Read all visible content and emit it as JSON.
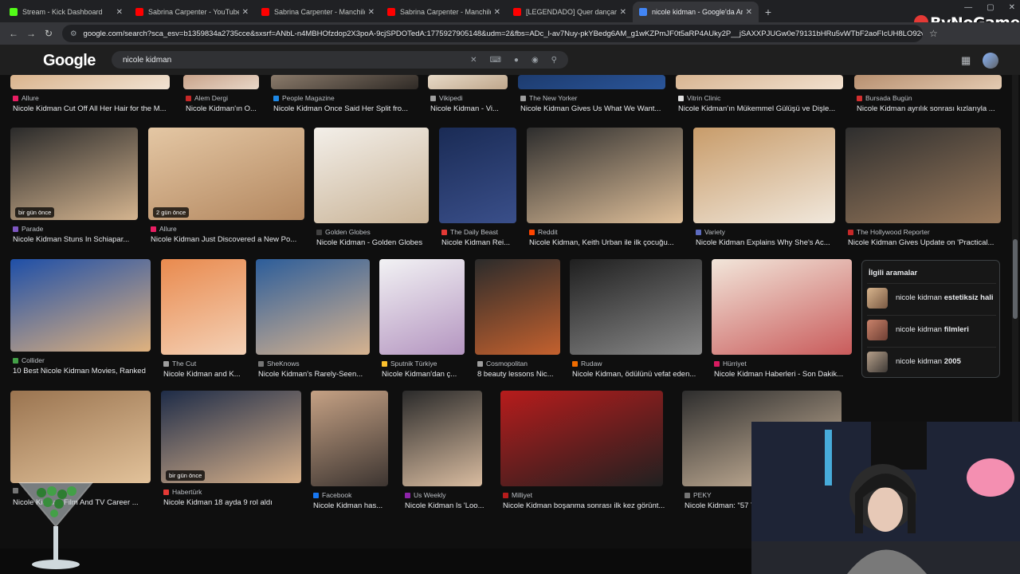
{
  "browser": {
    "tabs": [
      {
        "label": "Stream - Kick Dashboard",
        "favicon": "kick-icon",
        "color": "#53fc18",
        "active": false
      },
      {
        "label": "Sabrina Carpenter - YouTube",
        "favicon": "youtube-icon",
        "color": "#ff0000",
        "active": false
      },
      {
        "label": "Sabrina Carpenter - Manchild (",
        "favicon": "youtube-icon",
        "color": "#ff0000",
        "active": false
      },
      {
        "label": "Sabrina Carpenter - Manchild (",
        "favicon": "youtube-icon",
        "color": "#ff0000",
        "active": false
      },
      {
        "label": "[LEGENDADO] Quer dançar? Aı",
        "favicon": "youtube-icon",
        "color": "#ff0000",
        "active": false
      },
      {
        "label": "nicole kidman - Google'da Ara",
        "favicon": "google-icon",
        "color": "#4285f4",
        "active": true
      }
    ],
    "url": "google.com/search?sca_esv=b1359834a2735cce&sxsrf=ANbL-n4MBHOfzdop2X3poA-9cjSPDOTedA:1775927905148&udm=2&fbs=ADc_l-av7Nuy-pkYBedg6AM_g1wKZPmJF0t5aRP4AUky2P__jSAXXPJUGw0e79131bHRu5vWTbF2aoFIcUH8LO92vcJatS...",
    "overlay_brand": "ByNoGame"
  },
  "google": {
    "logo": "Google",
    "query": "nicole kidman"
  },
  "results": [
    {
      "src": "Allure",
      "cap": "Nicole Kidman Cut Off All Her Hair for the M...",
      "c": "#e91e63"
    },
    {
      "src": "Alem Dergi",
      "cap": "Nicole Kidman'ın O...",
      "c": "#c62828"
    },
    {
      "src": "People Magazine",
      "cap": "Nicole Kidman Once Said Her Split fro...",
      "c": "#1e88e5"
    },
    {
      "src": "Vikipedi",
      "cap": "Nicole Kidman - Vi...",
      "c": "#9e9e9e"
    },
    {
      "src": "The New Yorker",
      "cap": "Nicole Kidman Gives Us What We Want...",
      "c": "#9e9e9e"
    },
    {
      "src": "Vitrin Clinic",
      "cap": "Nicole Kidman'ın Mükemmel Gülüşü ve Dişle...",
      "c": "#e0e0e0"
    },
    {
      "src": "Bursada Bugün",
      "cap": "Nicole Kidman ayrılık sonrası kızlarıyla ...",
      "c": "#d32f2f"
    },
    {
      "src": "Parade",
      "cap": "Nicole Kidman Stuns In Schiapar...",
      "c": "#7e57c2",
      "badge": "bir gün önce"
    },
    {
      "src": "Allure",
      "cap": "Nicole Kidman Just Discovered a New Po...",
      "c": "#e91e63",
      "badge": "2 gün önce"
    },
    {
      "src": "Golden Globes",
      "cap": "Nicole Kidman - Golden Globes",
      "c": "#424242"
    },
    {
      "src": "The Daily Beast",
      "cap": "Nicole Kidman Rei...",
      "c": "#e53935"
    },
    {
      "src": "Reddit",
      "cap": "Nicole Kidman, Keith Urban ile ilk çocuğu...",
      "c": "#ff4500"
    },
    {
      "src": "Variety",
      "cap": "Nicole Kidman Explains Why She's Ac...",
      "c": "#5c6bc0"
    },
    {
      "src": "The Hollywood Reporter",
      "cap": "Nicole Kidman Gives Update on 'Practical...",
      "c": "#c62828"
    },
    {
      "src": "Collider",
      "cap": "10 Best Nicole Kidman Movies, Ranked",
      "c": "#43a047"
    },
    {
      "src": "The Cut",
      "cap": "Nicole Kidman and K...",
      "c": "#9e9e9e"
    },
    {
      "src": "SheKnows",
      "cap": "Nicole Kidman's Rarely-Seen...",
      "c": "#757575"
    },
    {
      "src": "Sputnik Türkiye",
      "cap": "Nicole Kidman'dan ç...",
      "c": "#fbc02d"
    },
    {
      "src": "Cosmopolitan",
      "cap": "8 beauty lessons Nic...",
      "c": "#9e9e9e"
    },
    {
      "src": "Rudaw",
      "cap": "Nicole Kidman, ödülünü vefat eden...",
      "c": "#ef6c00"
    },
    {
      "src": "Hürriyet",
      "cap": "Nicole Kidman Haberleri - Son Dakik...",
      "c": "#d81b60"
    },
    {
      "src": "",
      "cap": "Nicole Kidman Film And TV Career ...",
      "c": "#757575"
    },
    {
      "src": "Habertürk",
      "cap": "Nicole Kidman 18 ayda 9 rol aldı",
      "c": "#e53935",
      "badge": "bir gün önce"
    },
    {
      "src": "Facebook",
      "cap": "Nicole Kidman has...",
      "c": "#1877f2"
    },
    {
      "src": "Us Weekly",
      "cap": "Nicole Kidman Is 'Loo...",
      "c": "#8e24aa"
    },
    {
      "src": "Milliyet",
      "cap": "Nicole Kidman boşanma sonrası ilk kez görünt...",
      "c": "#b71c1c"
    },
    {
      "src": "PEKY",
      "cap": "Nicole Kidman: \"57 Y...",
      "c": "#757575"
    }
  ],
  "related": {
    "title": "İlgili aramalar",
    "items": [
      {
        "pre": "nicole kidman ",
        "bold": "estetiksiz hali"
      },
      {
        "pre": "nicole kidman ",
        "bold": "filmleri"
      },
      {
        "pre": "nicole kidman ",
        "bold": "2005"
      }
    ]
  }
}
